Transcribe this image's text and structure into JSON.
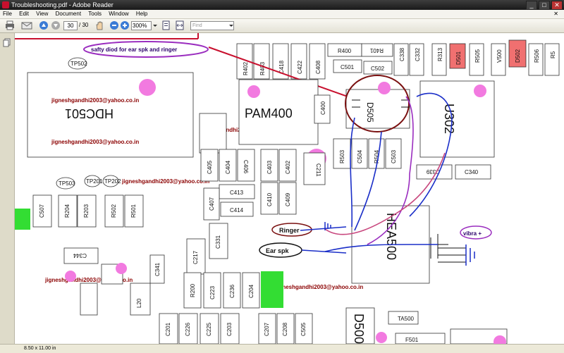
{
  "window": {
    "title": "Troubleshooting.pdf - Adobe Reader"
  },
  "menu": [
    "File",
    "Edit",
    "View",
    "Document",
    "Tools",
    "Window",
    "Help"
  ],
  "toolbar": {
    "page_current": "30",
    "page_total": "/ 30",
    "zoom": "300%",
    "find_placeholder": "Find"
  },
  "status": {
    "page_size": "8.50 x 11.00 in"
  },
  "colors": {
    "accent_red": "#c8102e",
    "trace_blue": "#1a2ec8",
    "trace_purple": "#9a2dbf",
    "pad_pink": "#f27ae0",
    "green": "#33dd33",
    "callout_circle": "#7a1010"
  },
  "schematic": {
    "annotation_top": "safty diod for ear spk and ringer",
    "email": "jigneshgandhi2003@yahoo.co.in",
    "ringer_label": "Ringer",
    "ear_label": "Ear spk",
    "vibra_label": "vibra +",
    "chips": {
      "hdc": "HDC501",
      "pam": "PAM400",
      "u302": "U302",
      "hea": "HEA500",
      "d500": "D500",
      "d505": "D505"
    },
    "components": [
      "R402",
      "R403",
      "C418",
      "C422",
      "C408",
      "R400",
      "R401",
      "C501",
      "C502",
      "C338",
      "C332",
      "R313",
      "D501",
      "R505",
      "V500",
      "D502",
      "R506",
      "R5",
      "C400",
      "R503",
      "C504",
      "R504",
      "C503",
      "C339",
      "C340",
      "TP502",
      "TP503",
      "TP201",
      "TP202",
      "C507",
      "R204",
      "R203",
      "R502",
      "R501",
      "C405",
      "C404",
      "C406",
      "C403",
      "C402",
      "C413",
      "C407",
      "C414",
      "C410",
      "C409",
      "TA400",
      "C211",
      "C217",
      "C331",
      "C344",
      "C341",
      "L20",
      "R200",
      "C223",
      "C236",
      "C204",
      "C201",
      "C226",
      "C225",
      "C203",
      "C207",
      "C208",
      "C505",
      "TA500",
      "F501"
    ]
  }
}
